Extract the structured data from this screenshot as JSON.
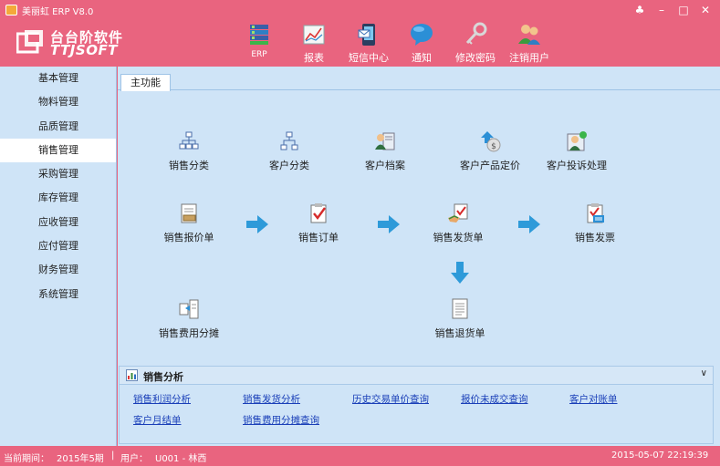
{
  "window": {
    "title": "美丽虹 ERP  V8.0"
  },
  "logo": {
    "cn": "台台阶软件",
    "en": "TTJSOFT"
  },
  "toolbar": [
    {
      "label": "ERP",
      "icon": "erp-icon"
    },
    {
      "label": "报表",
      "icon": "report-icon"
    },
    {
      "label": "短信中心",
      "icon": "sms-icon"
    },
    {
      "label": "通知",
      "icon": "notice-icon"
    },
    {
      "label": "修改密码",
      "icon": "key-icon"
    },
    {
      "label": "注销用户",
      "icon": "logout-users-icon"
    }
  ],
  "sidebar": {
    "items": [
      {
        "label": "基本管理"
      },
      {
        "label": "物料管理"
      },
      {
        "label": "品质管理"
      },
      {
        "label": "销售管理",
        "active": true
      },
      {
        "label": "采购管理"
      },
      {
        "label": "库存管理"
      },
      {
        "label": "应收管理"
      },
      {
        "label": "应付管理"
      },
      {
        "label": "财务管理"
      },
      {
        "label": "系统管理"
      }
    ]
  },
  "tabs": [
    {
      "label": "主功能"
    }
  ],
  "functions": [
    {
      "label": "销售分类",
      "icon": "category-tree-icon"
    },
    {
      "label": "客户分类",
      "icon": "customer-category-icon"
    },
    {
      "label": "客户档案",
      "icon": "customer-file-icon"
    },
    {
      "label": "客户产品定价",
      "icon": "pricing-icon"
    },
    {
      "label": "客户投诉处理",
      "icon": "complaint-icon"
    },
    {
      "label": "销售报价单",
      "icon": "quote-icon"
    },
    {
      "label": "销售订单",
      "icon": "order-icon"
    },
    {
      "label": "销售发货单",
      "icon": "delivery-icon"
    },
    {
      "label": "销售发票",
      "icon": "invoice-icon"
    },
    {
      "label": "销售费用分摊",
      "icon": "expense-icon"
    },
    {
      "label": "销售退货单",
      "icon": "return-icon"
    }
  ],
  "analysis": {
    "title": "销售分析",
    "links": [
      "销售利润分析",
      "销售发货分析",
      "历史交易单价查询",
      "报价未成交查询",
      "客户对账单",
      "客户月结单",
      "销售费用分摊查询"
    ]
  },
  "status": {
    "period_label": "当前期间：",
    "period_value": "2015年5期",
    "user_label": "用户：",
    "user_value": "U001 - 林西",
    "datetime": "2015-05-07 22:19:39"
  },
  "colors": {
    "header": "#e9647f",
    "panel": "#cfe4f7",
    "link": "#1a3fb8",
    "arrow": "#2e9ad9"
  }
}
